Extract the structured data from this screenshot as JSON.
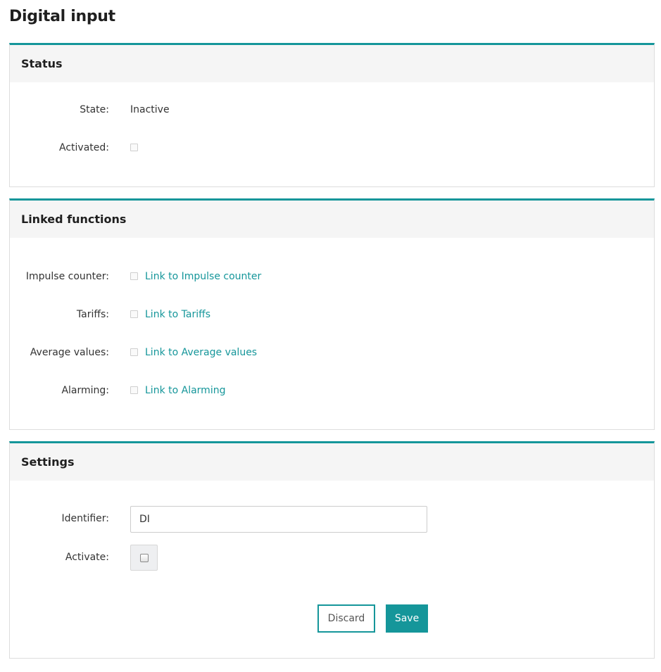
{
  "page": {
    "title": "Digital input"
  },
  "theme": {
    "accent": "#15969a",
    "header_bg": "#f5f5f5",
    "border": "#dddddd"
  },
  "status": {
    "title": "Status",
    "state_label": "State:",
    "state_value": "Inactive",
    "activated_label": "Activated:",
    "activated_checked": false
  },
  "linked_functions": {
    "title": "Linked functions",
    "items": [
      {
        "label": "Impulse counter:",
        "link": "Link to Impulse counter",
        "checked": false
      },
      {
        "label": "Tariffs:",
        "link": "Link to Tariffs",
        "checked": false
      },
      {
        "label": "Average values:",
        "link": "Link to Average values",
        "checked": false
      },
      {
        "label": "Alarming:",
        "link": "Link to Alarming",
        "checked": false
      }
    ]
  },
  "settings": {
    "title": "Settings",
    "identifier_label": "Identifier:",
    "identifier_value": "DI",
    "activate_label": "Activate:",
    "activate_checked": false,
    "discard_label": "Discard",
    "save_label": "Save"
  }
}
